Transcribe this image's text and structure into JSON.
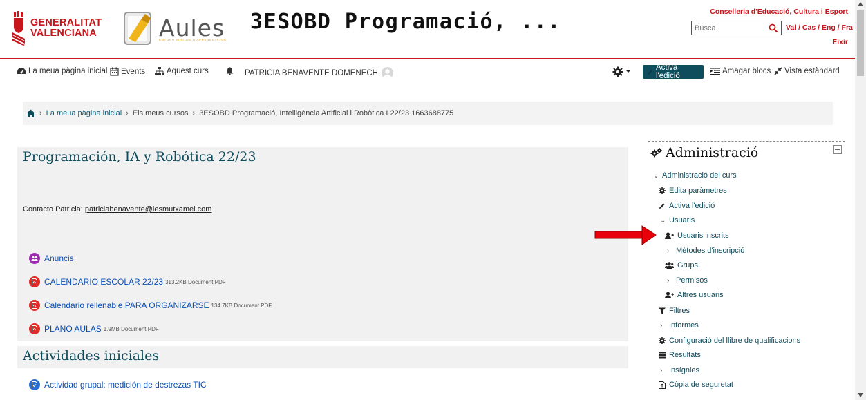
{
  "header": {
    "gva_logo_text": [
      "GENERALITAT",
      "VALENCIANA"
    ],
    "aules_logo_text": "Aules",
    "aules_tagline": "ENTORN VIRTUAL D'APRENENTATGE",
    "course_title": "3ESOBD Programació, ...",
    "conselleria": "Conselleria d'Educació, Cultura i Esport",
    "search_placeholder": "Busca",
    "languages": "Val / Cas / Eng / Fra",
    "exit": "Eixir"
  },
  "navbar": {
    "home": "La meua pàgina inicial",
    "events": "Events",
    "this_course": "Aquest curs",
    "user_name": "PATRICIA BENAVENTE DOMENECH",
    "edit_button": "Activa l'edició",
    "hide_blocks": "Amagar blocs",
    "standard_view": "Vista estàndard"
  },
  "breadcrumb": {
    "items": [
      "La meua pàgina inicial",
      "Els meus cursos",
      "3ESOBD Programació, Intelligència Artificial i Robòtica I 22/23 1663688775"
    ]
  },
  "main": {
    "section1_title": "Programación, IA y Robótica 22/23",
    "contact_label": "Contacto Patricia: ",
    "contact_email": "patriciabenavente@iesmutxamel.com",
    "activities": [
      {
        "name": "Anuncis",
        "meta": "",
        "icon": "forum-icon",
        "color": "#9b2ab0"
      },
      {
        "name": "CALENDARIO ESCOLAR 22/23",
        "meta": "313.2KB Document PDF",
        "icon": "pdf-icon",
        "color": "#e02b27"
      },
      {
        "name": "Calendario rellenable PARA ORGANIZARSE",
        "meta": "134.7KB Document PDF",
        "icon": "pdf-icon",
        "color": "#e02b27"
      },
      {
        "name": "PLANO AULAS",
        "meta": "1.9MB Document PDF",
        "icon": "pdf-icon",
        "color": "#e02b27"
      }
    ],
    "section2_title": "Actividades iniciales",
    "section2_activity": {
      "name": "Actividad grupal: medición de destrezas TIC",
      "icon": "assignment-icon",
      "color": "#2a6ecf"
    }
  },
  "admin": {
    "title": "Administració",
    "course_admin": "Administració del curs",
    "items": {
      "edit_settings": "Edita paràmetres",
      "turn_editing": "Activa l'edició",
      "users": "Usuaris",
      "enrolled_users": "Usuaris inscrits",
      "enrolment_methods": "Mètodes d'inscripció",
      "groups": "Grups",
      "permissions": "Permisos",
      "other_users": "Altres usuaris",
      "filters": "Filtres",
      "reports": "Informes",
      "gradebook_setup": "Configuració del llibre de qualificacions",
      "outcomes": "Resultats",
      "badges": "Insígnies",
      "backup": "Còpia de seguretat"
    }
  },
  "colors": {
    "brand_red": "#c8161d",
    "accent_teal": "#0f4c5c",
    "arrow_red": "#e8000b"
  }
}
